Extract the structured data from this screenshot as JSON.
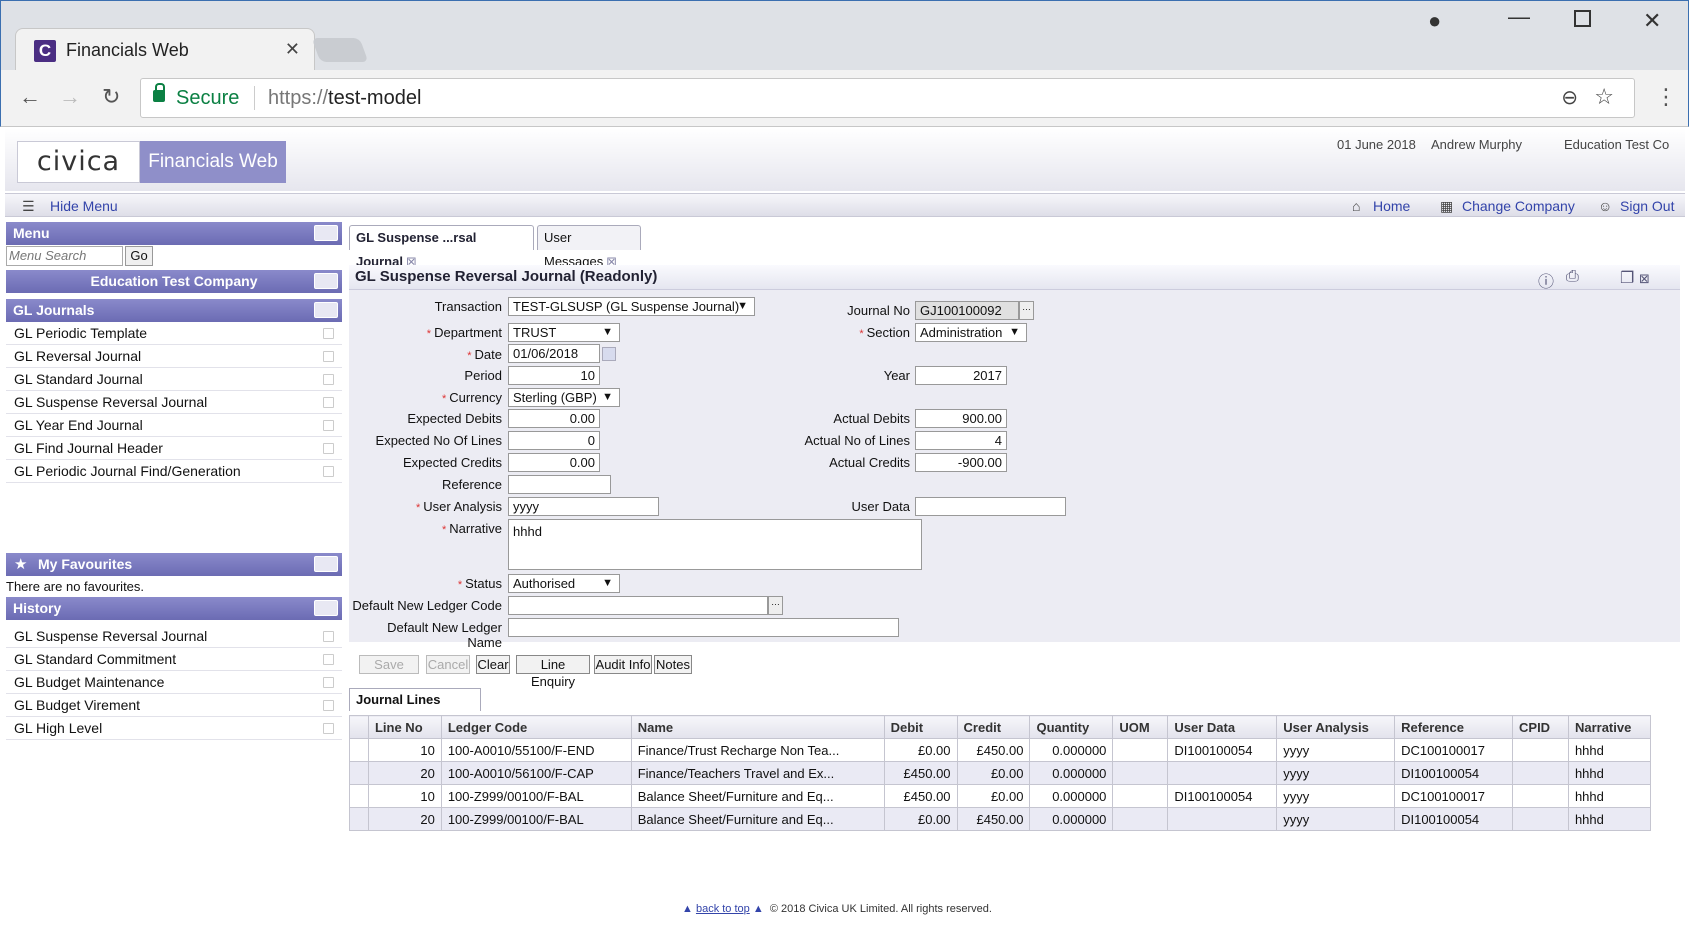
{
  "browser": {
    "tab_title": "Financials Web",
    "favicon_letter": "C",
    "secure_label": "Secure",
    "url_scheme": "https://",
    "url_host": "test-model"
  },
  "app": {
    "logo": "civica",
    "product": "Financials Web",
    "date": "01 June 2018",
    "user": "Andrew Murphy",
    "company": "Education Test Co"
  },
  "toolbar": {
    "hide_menu": "Hide Menu",
    "home": "Home",
    "change_company": "Change Company",
    "sign_out": "Sign Out"
  },
  "sidebar": {
    "menu_title": "Menu",
    "search_placeholder": "Menu Search",
    "go_label": "Go",
    "company": "Education Test Company",
    "section": "GL Journals",
    "items": [
      "GL Periodic Template",
      "GL Reversal Journal",
      "GL Standard Journal",
      "GL Suspense Reversal Journal",
      "GL Year End Journal",
      "GL Find Journal Header",
      "GL Periodic Journal Find/Generation"
    ],
    "favourites_title": "My Favourites",
    "favourites_empty": "There are no favourites.",
    "history_title": "History",
    "history": [
      "GL Suspense Reversal Journal",
      "GL Standard Commitment",
      "GL Budget Maintenance",
      "GL Budget Virement",
      "GL High Level"
    ]
  },
  "content_tabs": [
    {
      "label": "GL Suspense ...rsal Journal"
    },
    {
      "label": "User Messages"
    }
  ],
  "form": {
    "title": "GL Suspense Reversal Journal (Readonly)",
    "transaction_label": "Transaction",
    "transaction": "TEST-GLSUSP (GL Suspense Journal)",
    "journal_no_label": "Journal No",
    "journal_no": "GJ100100092",
    "department_label": "Department",
    "department": "TRUST",
    "section_label": "Section",
    "section": "Administration",
    "date_label": "Date",
    "date": "01/06/2018",
    "period_label": "Period",
    "period": "10",
    "year_label": "Year",
    "year": "2017",
    "currency_label": "Currency",
    "currency": "Sterling (GBP)",
    "exp_debits_label": "Expected Debits",
    "exp_debits": "0.00",
    "act_debits_label": "Actual Debits",
    "act_debits": "900.00",
    "exp_lines_label": "Expected No Of Lines",
    "exp_lines": "0",
    "act_lines_label": "Actual No of Lines",
    "act_lines": "4",
    "exp_credits_label": "Expected Credits",
    "exp_credits": "0.00",
    "act_credits_label": "Actual Credits",
    "act_credits": "-900.00",
    "reference_label": "Reference",
    "reference": "",
    "user_analysis_label": "User Analysis",
    "user_analysis": "yyyy",
    "user_data_label": "User Data",
    "user_data": "",
    "narrative_label": "Narrative",
    "narrative": "hhhd",
    "status_label": "Status",
    "status": "Authorised",
    "def_ledger_code_label": "Default New Ledger Code",
    "def_ledger_code": "",
    "def_ledger_name_label": "Default New Ledger Name",
    "def_ledger_name": "",
    "required_mark": "*",
    "buttons": {
      "save": "Save",
      "cancel": "Cancel",
      "clear": "Clear",
      "line_enquiry": "Line Enquiry",
      "audit_info": "Audit Info",
      "notes": "Notes"
    }
  },
  "journal_lines": {
    "tab": "Journal Lines",
    "columns": [
      "Line No",
      "Ledger Code",
      "Name",
      "Debit",
      "Credit",
      "Quantity",
      "UOM",
      "User Data",
      "User Analysis",
      "Reference",
      "CPID",
      "Narrative"
    ],
    "rows": [
      [
        "10",
        "100-A0010/55100/F-END",
        "Finance/Trust Recharge Non Tea...",
        "£0.00",
        "£450.00",
        "0.000000",
        "",
        "DI100100054",
        "yyyy",
        "DC100100017",
        "",
        "hhhd"
      ],
      [
        "20",
        "100-A0010/56100/F-CAP",
        "Finance/Teachers Travel and Ex...",
        "£450.00",
        "£0.00",
        "0.000000",
        "",
        "",
        "yyyy",
        "DI100100054",
        "",
        "hhhd"
      ],
      [
        "10",
        "100-Z999/00100/F-BAL",
        "Balance Sheet/Furniture and Eq...",
        "£450.00",
        "£0.00",
        "0.000000",
        "",
        "DI100100054",
        "yyyy",
        "DC100100017",
        "",
        "hhhd"
      ],
      [
        "20",
        "100-Z999/00100/F-BAL",
        "Balance Sheet/Furniture and Eq...",
        "£0.00",
        "£450.00",
        "0.000000",
        "",
        "",
        "yyyy",
        "DI100100054",
        "",
        "hhhd"
      ]
    ]
  },
  "footer": {
    "back_to_top": "back to top",
    "copyright": "© 2018 Civica UK Limited. All rights reserved."
  }
}
